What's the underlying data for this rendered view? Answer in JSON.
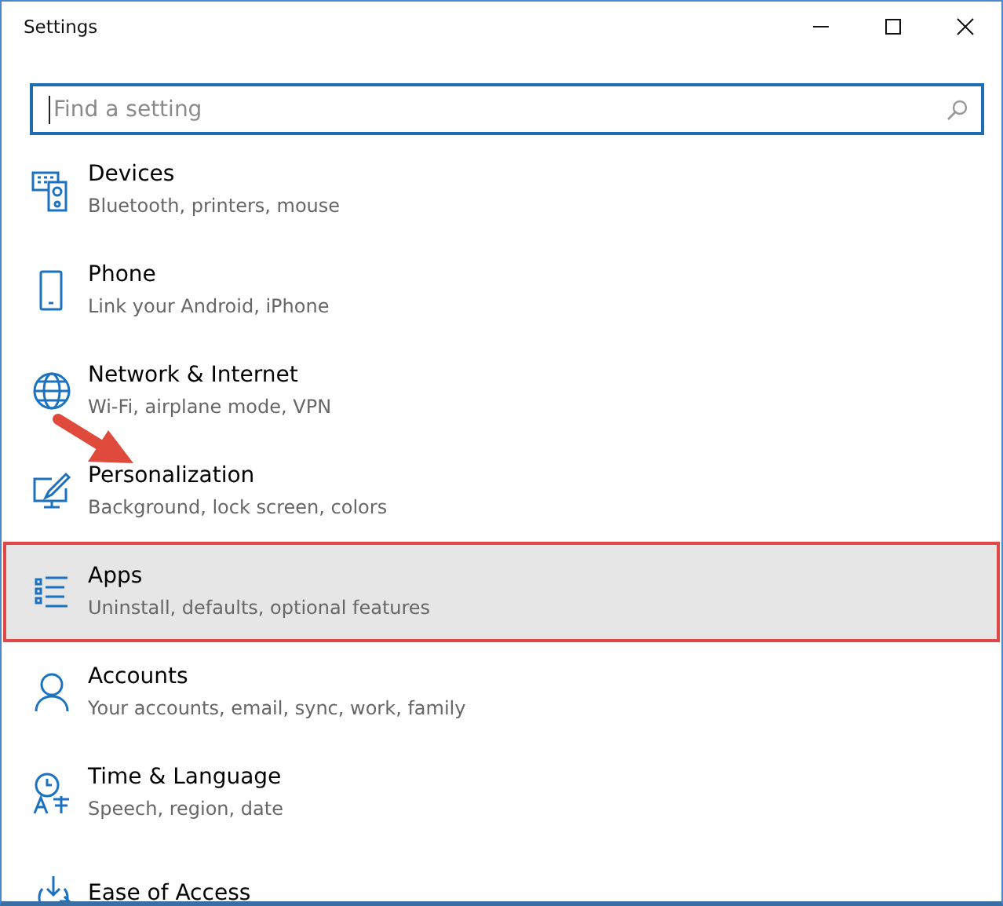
{
  "window": {
    "title": "Settings"
  },
  "search": {
    "placeholder": "Find a setting"
  },
  "items": [
    {
      "title": "Devices",
      "subtitle": "Bluetooth, printers, mouse",
      "selected": false,
      "marked": false
    },
    {
      "title": "Phone",
      "subtitle": "Link your Android, iPhone",
      "selected": false,
      "marked": false
    },
    {
      "title": "Network & Internet",
      "subtitle": "Wi-Fi, airplane mode, VPN",
      "selected": false,
      "marked": false
    },
    {
      "title": "Personalization",
      "subtitle": "Background, lock screen, colors",
      "selected": false,
      "marked": false
    },
    {
      "title": "Apps",
      "subtitle": "Uninstall, defaults, optional features",
      "selected": true,
      "marked": true
    },
    {
      "title": "Accounts",
      "subtitle": "Your accounts, email, sync, work, family",
      "selected": false,
      "marked": false
    },
    {
      "title": "Time & Language",
      "subtitle": "Speech, region, date",
      "selected": false,
      "marked": false
    },
    {
      "title": "Ease of Access",
      "selected": false,
      "marked": false
    }
  ]
}
